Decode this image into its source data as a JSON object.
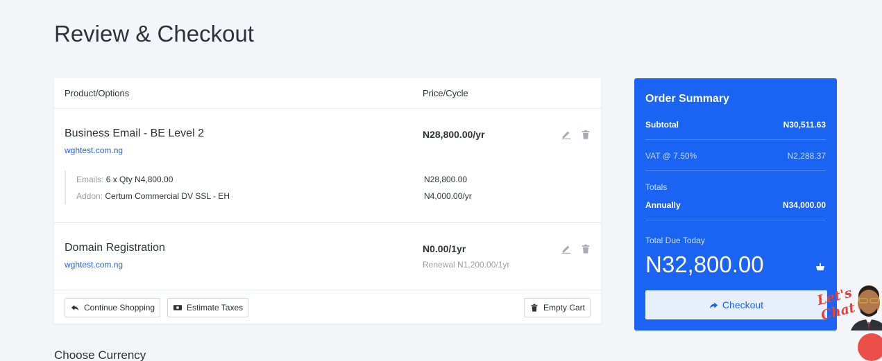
{
  "page": {
    "title": "Review & Checkout"
  },
  "cart": {
    "headers": {
      "product": "Product/Options",
      "price": "Price/Cycle"
    },
    "items": [
      {
        "name": "Business Email - BE Level 2",
        "domain": "wghtest.com.ng",
        "price": "N28,800.00/yr",
        "options": [
          {
            "label": "Emails:",
            "value": "6 x Qty N4,800.00",
            "price": "N28,800.00"
          },
          {
            "label": "Addon:",
            "value": "Certum Commercial DV SSL - EH",
            "price": "N4,000.00/yr"
          }
        ],
        "edit_icon": "pencil-icon",
        "delete_icon": "trash-icon"
      },
      {
        "name": "Domain Registration",
        "domain": "wghtest.com.ng",
        "price": "N0.00/1yr",
        "renewal": "Renewal N1,200.00/1yr",
        "edit_icon": "pencil-icon",
        "delete_icon": "trash-icon"
      }
    ],
    "footer": {
      "continue_shopping": "Continue Shopping",
      "estimate_taxes": "Estimate Taxes",
      "empty_cart": "Empty Cart"
    }
  },
  "summary": {
    "title": "Order Summary",
    "subtotal_label": "Subtotal",
    "subtotal_value": "N30,511.63",
    "vat_label": "VAT @ 7.50%",
    "vat_value": "N2,288.37",
    "totals_label": "Totals",
    "annually_label": "Annually",
    "annually_value": "N34,000.00",
    "due_label": "Total Due Today",
    "due_value": "N32,800.00",
    "checkout_label": "Checkout",
    "accent_color": "#1a63f3"
  },
  "currency_section": {
    "title": "Choose Currency"
  },
  "chat_widget": {
    "text_line1": "Let's",
    "text_line2": "Chat"
  }
}
